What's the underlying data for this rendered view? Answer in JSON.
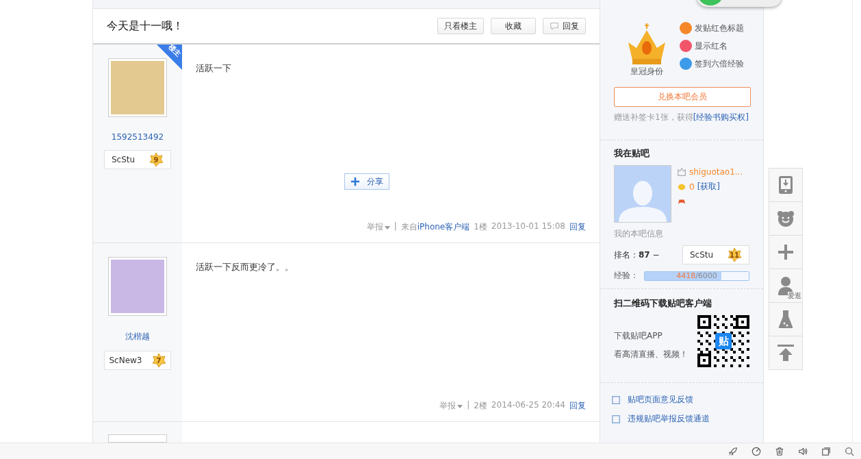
{
  "thread": {
    "title": "今天是十一哦！",
    "actions": [
      {
        "label": "只看楼主",
        "kind": "plain"
      },
      {
        "label": "收藏",
        "kind": "plain"
      },
      {
        "label": "回复",
        "kind": "reply"
      }
    ]
  },
  "posts": [
    {
      "author": "1592513492",
      "badge_name": "ScStu",
      "badge_level": "9",
      "is_op": true,
      "op_label": "楼主",
      "content": "活跃一下",
      "share": "分享",
      "report": "举报",
      "separator": "|",
      "source_prefix": "来自",
      "source": "iPhone客户端",
      "floor": "1楼",
      "time": "2013-10-01 15:08",
      "reply": "回复"
    },
    {
      "author": "沈楷越",
      "badge_name": "ScNew3",
      "badge_level": "7",
      "is_op": false,
      "content": "活跃一下反而更冷了。。",
      "report": "举报",
      "separator": "|",
      "floor": "2楼",
      "time": "2014-06-25 20:44",
      "reply": "回复"
    }
  ],
  "sidebar": {
    "member": {
      "crown_label": "皇冠身份",
      "perks": [
        {
          "label": "发贴红色标题",
          "color": "#f5892a"
        },
        {
          "label": "显示红名",
          "color": "#f2556a"
        },
        {
          "label": "签到六倍经验",
          "color": "#3d9be9"
        }
      ],
      "button": "兑换本吧会员",
      "note": "赠送补签卡1张，获得",
      "note_link": "[经验书购买权]"
    },
    "me": {
      "heading": "我在贴吧",
      "username": "shiguotao1...",
      "coins": "0",
      "coins_link": "[获取]",
      "info_label": "我的本吧信息",
      "rank_label": "排名：",
      "rank": "87",
      "rank_trend": "−",
      "badge_name": "ScStu",
      "badge_level": "11",
      "exp_label": "经验：",
      "exp_current": "4418",
      "exp_total": "/6000",
      "level": 0.736
    },
    "qr": {
      "heading": "扫二维码下载贴吧客户端",
      "lines": [
        "下载贴吧APP",
        "看高清直播、视频！"
      ],
      "logo": "贴"
    },
    "links": [
      {
        "label": "贴吧页面意见反馈"
      },
      {
        "label": "违规贴吧举报反馈通道"
      }
    ]
  },
  "side_tools": [
    {
      "kind": "phone"
    },
    {
      "kind": "bear"
    },
    {
      "kind": "plus"
    },
    {
      "kind": "person",
      "label": "爱逛"
    },
    {
      "kind": "flask"
    },
    {
      "kind": "top"
    }
  ],
  "browser_tools": [
    {
      "kind": "rocket"
    },
    {
      "kind": "speed"
    },
    {
      "kind": "trash"
    },
    {
      "kind": "sound"
    },
    {
      "kind": "window"
    },
    {
      "kind": "search"
    }
  ]
}
